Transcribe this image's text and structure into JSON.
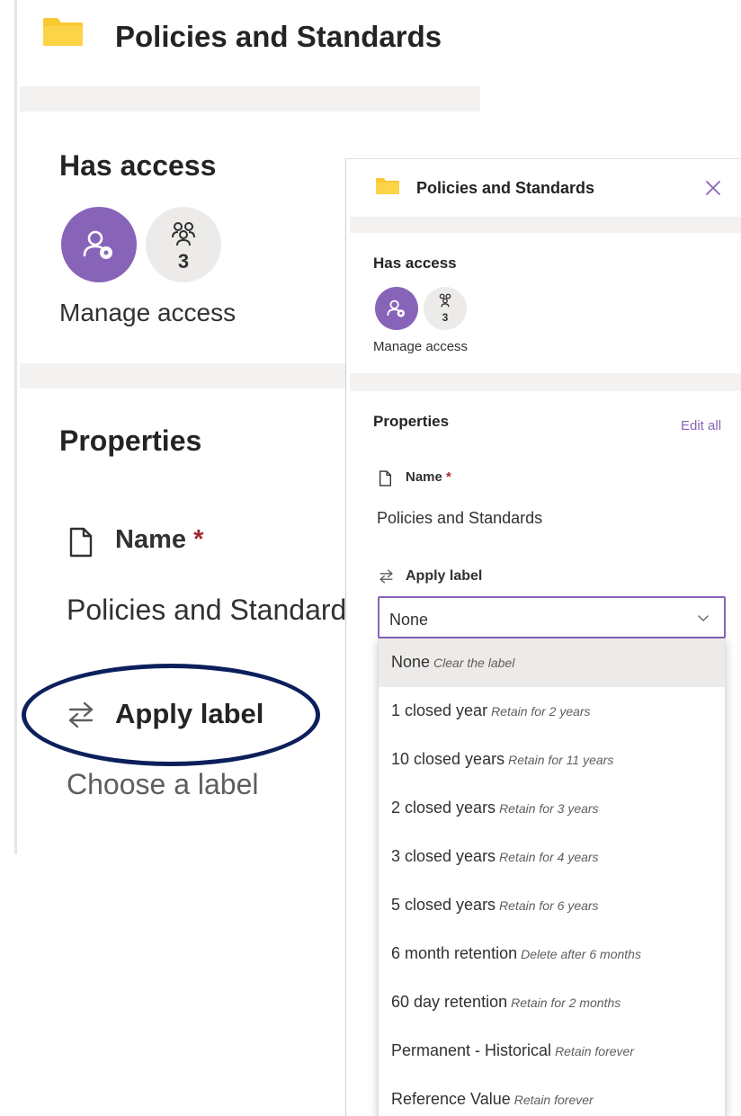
{
  "zoomed": {
    "title": "Policies and Standards",
    "access_heading": "Has access",
    "members_count": "3",
    "manage_access": "Manage access",
    "properties_heading": "Properties",
    "name_label": "Name",
    "required_mark": "*",
    "name_value": "Policies and Standards",
    "apply_label": "Apply label",
    "label_placeholder": "Choose a label"
  },
  "panel": {
    "title": "Policies and Standards",
    "access_heading": "Has access",
    "members_count": "3",
    "manage_access": "Manage access",
    "properties_heading": "Properties",
    "edit_all": "Edit all",
    "name_label": "Name",
    "required_mark": "*",
    "name_value": "Policies and Standards",
    "apply_label": "Apply label",
    "selected_label": "None",
    "options": [
      {
        "name": "None",
        "desc": "Clear the label"
      },
      {
        "name": "1 closed year",
        "desc": "Retain for 2 years"
      },
      {
        "name": "10 closed years",
        "desc": "Retain for 11 years"
      },
      {
        "name": "2 closed years",
        "desc": "Retain for 3 years"
      },
      {
        "name": "3 closed years",
        "desc": "Retain for 4 years"
      },
      {
        "name": "5 closed years",
        "desc": "Retain for 6 years"
      },
      {
        "name": "6 month retention",
        "desc": "Delete after 6 months"
      },
      {
        "name": "60 day retention",
        "desc": "Retain for 2 months"
      },
      {
        "name": "Permanent - Historical",
        "desc": "Retain forever"
      },
      {
        "name": "Reference Value",
        "desc": "Retain forever"
      }
    ]
  },
  "colors": {
    "accent": "#8764b8",
    "folder": "#f8c932",
    "highlight_ring": "#0c1f5c",
    "required": "#a4262c"
  },
  "icons": {
    "folder": "folder-icon",
    "owner": "people-settings-icon",
    "members": "group-icon",
    "name": "document-icon",
    "apply_label": "swap-arrows-icon",
    "close": "close-icon",
    "dropdown": "chevron-down-icon"
  }
}
